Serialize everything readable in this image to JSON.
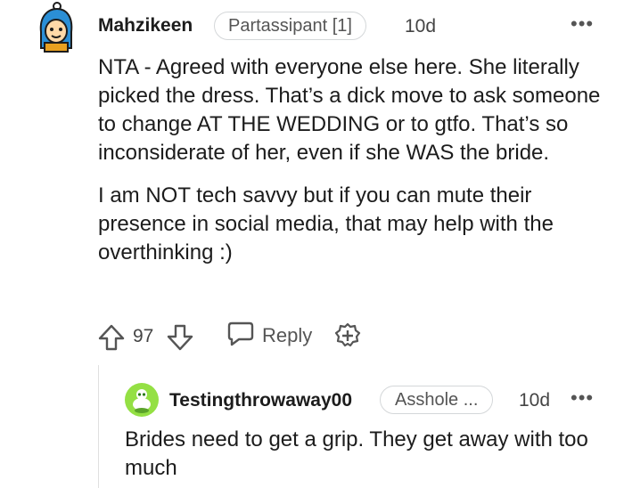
{
  "comment1": {
    "username": "Mahzikeen",
    "flair": "Partassipant [1]",
    "time": "10d",
    "more": "•••",
    "paragraphs": [
      "NTA - Agreed with everyone else here. She literally picked the dress. That’s a dick move to ask someone to change AT THE WEDDING or to gtfo. That’s so inconsiderate of her, even if she WAS the bride.",
      "I am NOT tech savvy but if you can mute their presence in social media, that may help with the overthinking :)"
    ],
    "score": "97",
    "reply_label": "Reply"
  },
  "comment2": {
    "username": "Testingthrowaway00",
    "flair": "Asshole ...",
    "time": "10d",
    "more": "•••",
    "body": "Brides need to get a grip. They get away with too much"
  },
  "colors": {
    "text": "#1c1c1c",
    "meta": "#555555",
    "border": "#d4d7d9",
    "avatar2_bg": "#94e044"
  },
  "icons": [
    "avatar-icon",
    "upvote-icon",
    "downvote-icon",
    "reply-icon",
    "award-icon",
    "more-icon"
  ]
}
